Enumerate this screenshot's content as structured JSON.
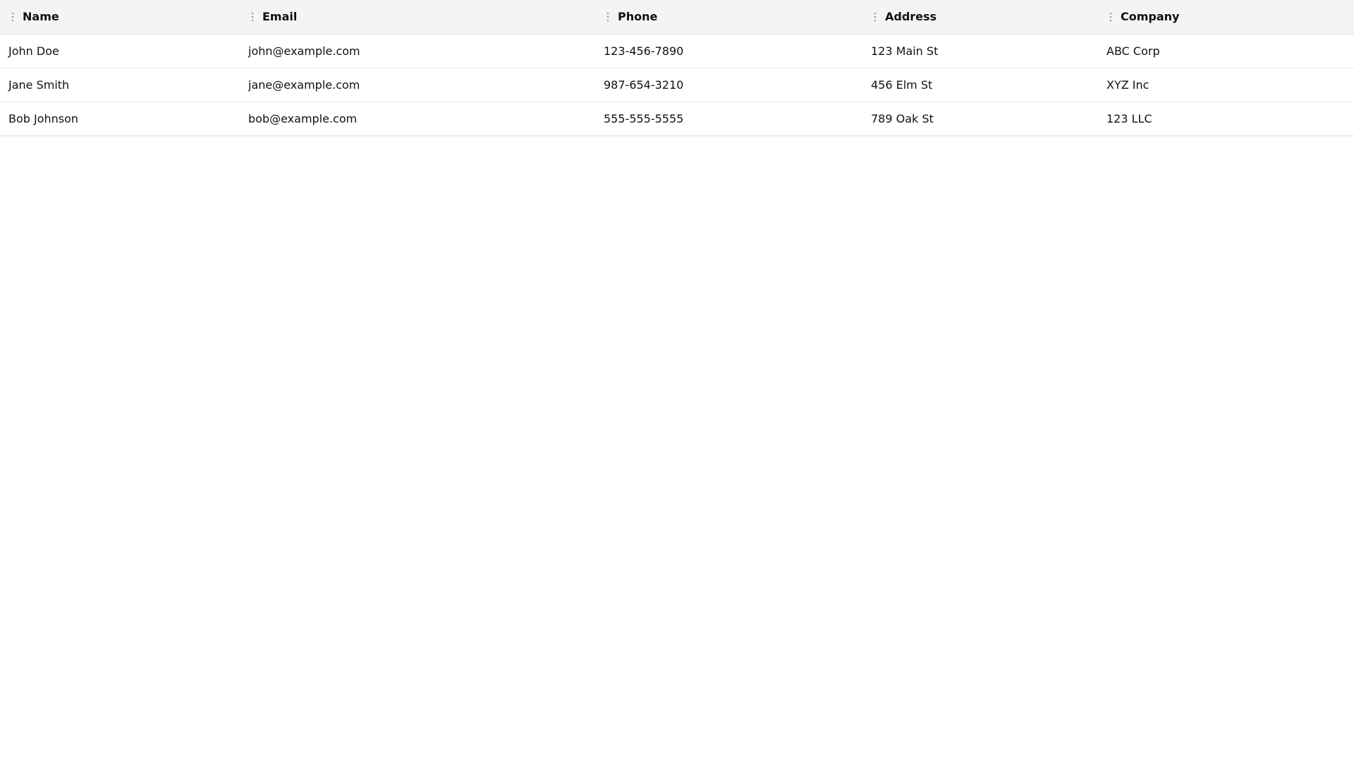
{
  "table": {
    "columns": [
      {
        "key": "name",
        "label": "Name",
        "icon": "drag-handle-icon"
      },
      {
        "key": "email",
        "label": "Email",
        "icon": "drag-handle-icon"
      },
      {
        "key": "phone",
        "label": "Phone",
        "icon": "drag-handle-icon"
      },
      {
        "key": "address",
        "label": "Address",
        "icon": "drag-handle-icon"
      },
      {
        "key": "company",
        "label": "Company",
        "icon": "drag-handle-icon"
      }
    ],
    "rows": [
      {
        "name": "John Doe",
        "email": "john@example.com",
        "phone": "123-456-7890",
        "address": "123 Main St",
        "company": "ABC Corp"
      },
      {
        "name": "Jane Smith",
        "email": "jane@example.com",
        "phone": "987-654-3210",
        "address": "456 Elm St",
        "company": "XYZ Inc"
      },
      {
        "name": "Bob Johnson",
        "email": "bob@example.com",
        "phone": "555-555-5555",
        "address": "789 Oak St",
        "company": "123 LLC"
      }
    ]
  },
  "colors": {
    "header_background": "#f3f4f6",
    "row_divider": "#e5e7eb",
    "handle_icon": "#9ca3af"
  }
}
